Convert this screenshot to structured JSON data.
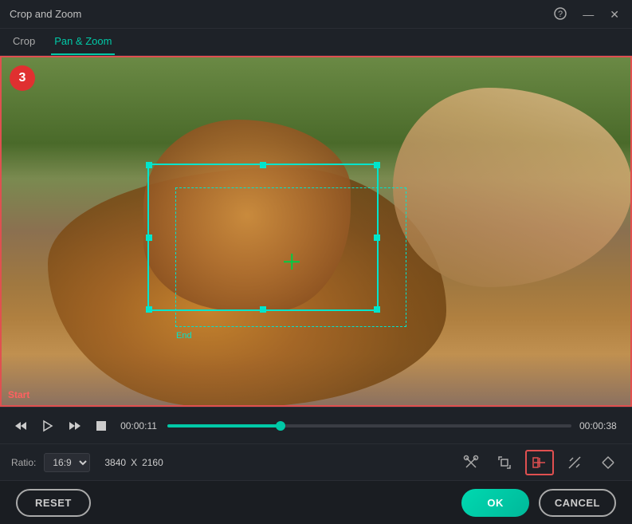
{
  "window": {
    "title": "Crop and Zoom",
    "helpIcon": "?",
    "minimizeIcon": "—",
    "closeIcon": "✕"
  },
  "tabs": [
    {
      "id": "crop",
      "label": "Crop",
      "active": false
    },
    {
      "id": "pan-zoom",
      "label": "Pan & Zoom",
      "active": true
    }
  ],
  "video": {
    "badgeNumber": "3",
    "startLabel": "Start",
    "endLabel": "End",
    "currentTime": "00:00:11",
    "totalTime": "00:00:38",
    "progressPercent": 28
  },
  "settings": {
    "ratioLabel": "Ratio:",
    "ratioValue": "16:9",
    "width": "3840",
    "separator": "X",
    "height": "2160"
  },
  "toolbar": {
    "cutIcon": "scissors",
    "cropIcon": "crop",
    "splitIcon": "split",
    "linkIcon": "link",
    "flipIcon": "flip"
  },
  "actions": {
    "resetLabel": "RESET",
    "okLabel": "OK",
    "cancelLabel": "CANCEL"
  }
}
